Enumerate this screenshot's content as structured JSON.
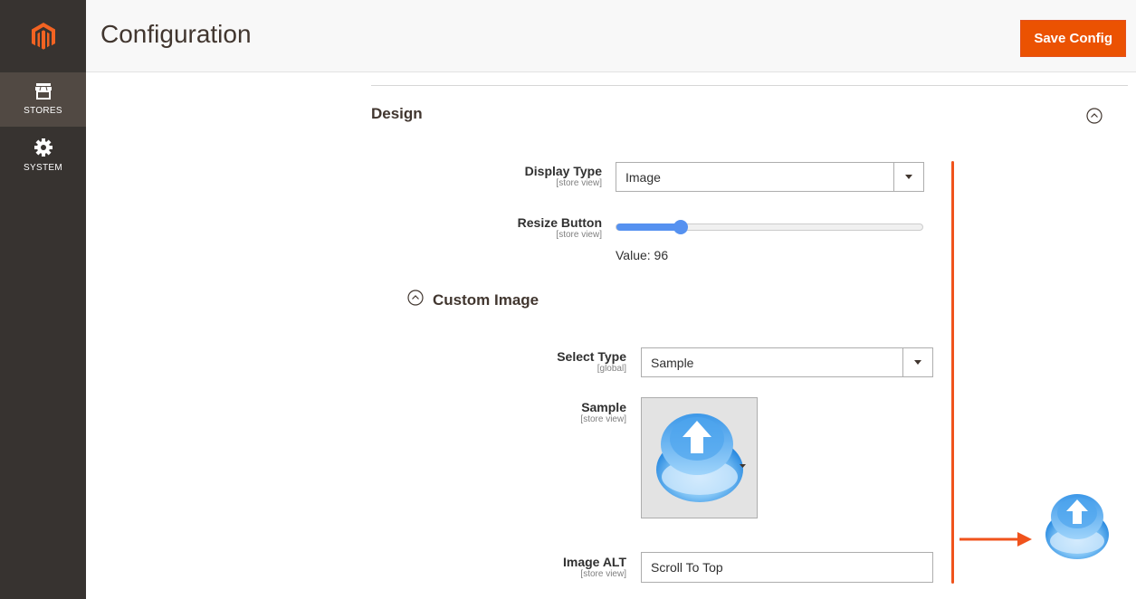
{
  "header": {
    "title": "Configuration",
    "save_label": "Save Config"
  },
  "sidebar": {
    "items": [
      {
        "label": "STORES",
        "icon": "store-icon",
        "active": true
      },
      {
        "label": "SYSTEM",
        "icon": "gear-icon",
        "active": false
      }
    ]
  },
  "design": {
    "title": "Design",
    "display_type": {
      "label": "Display Type",
      "scope": "[store view]",
      "value": "Image"
    },
    "resize_button": {
      "label": "Resize Button",
      "scope": "[store view]",
      "value_text": "Value: 96",
      "fill_fraction": 0.21
    },
    "custom_image": {
      "title": "Custom Image",
      "select_type": {
        "label": "Select Type",
        "scope": "[global]",
        "value": "Sample"
      },
      "sample": {
        "label": "Sample",
        "scope": "[store view]"
      },
      "image_alt": {
        "label": "Image ALT",
        "scope": "[store view]",
        "value": "Scroll To Top"
      }
    }
  },
  "colors": {
    "accent": "#eb5202",
    "sidebar": "#373330",
    "slider": "#5591f0",
    "annotation": "#f0531c"
  }
}
